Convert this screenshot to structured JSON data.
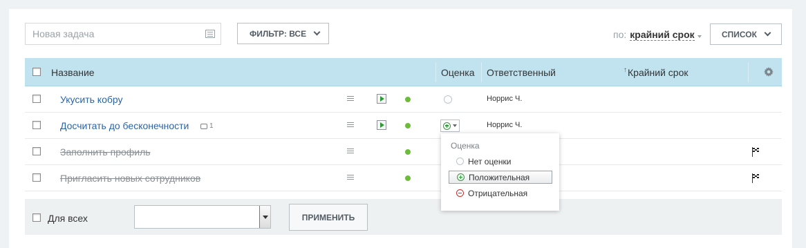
{
  "toolbar": {
    "new_task_placeholder": "Новая задача",
    "filter_label": "ФИЛЬТР: ВСЕ",
    "sort_prefix": "по:",
    "sort_value": "крайний срок",
    "view_label": "СПИСОК"
  },
  "table": {
    "columns": {
      "name": "Название",
      "mark": "Оценка",
      "responsible": "Ответственный",
      "deadline": "Крайний срок"
    },
    "rows": [
      {
        "title": "Укусить кобру",
        "responsible": "Норрис Ч."
      },
      {
        "title": "Досчитать до бесконечности",
        "comments": "1",
        "responsible": "Норрис Ч."
      },
      {
        "title": "Заполнить профиль"
      },
      {
        "title": "Пригласить новых сотрудников"
      }
    ]
  },
  "footer": {
    "for_all_label": "Для всех",
    "apply_label": "ПРИМЕНИТЬ"
  },
  "mark_popup": {
    "title": "Оценка",
    "options": [
      "Нет оценки",
      "Положительная",
      "Отрицательная"
    ],
    "selected": "Положительная"
  },
  "colors": {
    "header_bg": "#c1e2ef",
    "link": "#2a64a9",
    "status_green": "#6cbc3a",
    "positive": "#2e9a35",
    "negative": "#d22b2b"
  },
  "icons": [
    "note-icon",
    "chevron-down-icon",
    "settings-gear-icon",
    "menu-lines-icon",
    "play-icon",
    "status-dot-icon",
    "comment-icon",
    "plus-circle-icon",
    "minus-circle-icon",
    "finish-flag-icon"
  ]
}
